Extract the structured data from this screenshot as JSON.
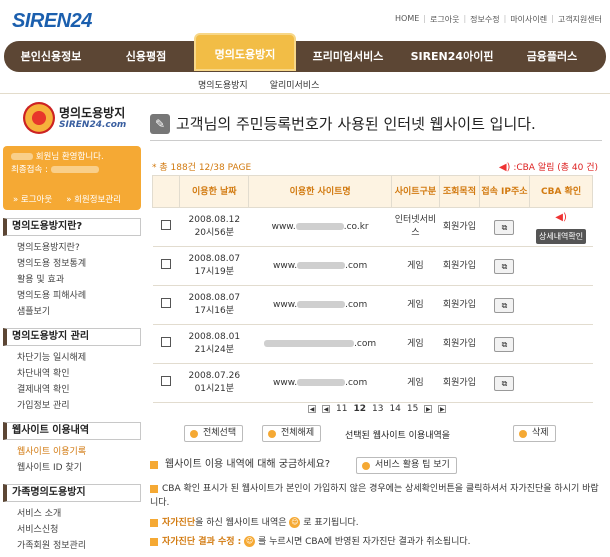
{
  "header": {
    "logo_text": "SIREN24",
    "top_links": [
      "HOME",
      "로그아웃",
      "정보수정",
      "마이사이렌",
      "고객지원센터"
    ]
  },
  "gnb": [
    "본인신용정보",
    "신용평점",
    "명의도용방지",
    "프리미엄서비스",
    "SIREN24아이핀",
    "금융플러스"
  ],
  "subnav": [
    "명의도용방지",
    "알리미서비스"
  ],
  "sidebar": {
    "title": "명의도용방지",
    "subtitle": "SIREN24.com",
    "login_line1": "회원님 환영합니다.",
    "login_line2": "최종접속 :",
    "logout": "» 로그아웃",
    "member_info": "» 회원정보관리",
    "sections": [
      {
        "head": "명의도용방지란?",
        "items": [
          "명의도용방지란?",
          "명의도용 정보통계",
          "활용 및 효과",
          "명의도용 피해사례",
          "샘플보기"
        ]
      },
      {
        "head": "명의도용방지 관리",
        "items": [
          "차단기능 일시해제",
          "차단내역 확인",
          "결제내역 확인",
          "가입정보 관리"
        ]
      },
      {
        "head": "웹사이트 이용내역",
        "items": [
          "웹사이트 이용기록",
          "웹사이트 ID 찾기"
        ]
      },
      {
        "head": "가족명의도용방지",
        "items": [
          "서비스 소개",
          "서비스신청",
          "가족회원 정보관리"
        ]
      }
    ]
  },
  "main": {
    "title": "고객님의 주민등록번호가 사용된 인터넷 웹사이트 입니다.",
    "count": "* 총 188건 12/38 PAGE",
    "cba_alert": ":CBA 알림 (총 40 건)",
    "columns": [
      "이용한 날짜",
      "이용한 사이트명",
      "사이트구분",
      "조회목적",
      "접속 IP주소",
      "CBA 확인"
    ],
    "rows": [
      {
        "date": "2008.08.12",
        "time": "20시56분",
        "site_pre": "www.",
        "site_post": ".co.kr",
        "type": "인터넷서비스",
        "purpose": "회원가입",
        "cba": "상세내역확인"
      },
      {
        "date": "2008.08.07",
        "time": "17시19분",
        "site_pre": "www.",
        "site_post": ".com",
        "type": "게임",
        "purpose": "회원가입",
        "cba": ""
      },
      {
        "date": "2008.08.07",
        "time": "17시16분",
        "site_pre": "www.",
        "site_post": ".com",
        "type": "게임",
        "purpose": "회원가입",
        "cba": ""
      },
      {
        "date": "2008.08.01",
        "time": "21시24분",
        "site_pre": "",
        "site_post": ".com",
        "type": "게임",
        "purpose": "회원가입",
        "cba": ""
      },
      {
        "date": "2008.07.26",
        "time": "01시21분",
        "site_pre": "www.",
        "site_post": ".com",
        "type": "게임",
        "purpose": "회원가입",
        "cba": ""
      }
    ],
    "pages": [
      "11",
      "12",
      "13",
      "14",
      "15"
    ],
    "current_page": "12",
    "select_all": "전체선택",
    "deselect_all": "전체해제",
    "selected_label": "선택된 웹사이트 이용내역을",
    "delete": "삭제",
    "question": "웹사이트 이용 내역에 대해 궁금하세요?",
    "tip_button": "서비스 활용 팁 보기",
    "note1": "CBA 확인 표시가 된 웹사이트가 본인이 가입하지 않은 경우에는 상세확인버튼을 클릭하셔서 자가진단을 하시기 바랍니다.",
    "note2_bold": "자가진단",
    "note2_rest": "을 하신 웹사이트 내역은",
    "note2_end": "로 표기됩니다.",
    "note3_bold": "자가진단 결과 수정 :",
    "note3_rest": "를 누르시면 CBA에 반영된 자가진단 결과가 취소됩니다."
  }
}
